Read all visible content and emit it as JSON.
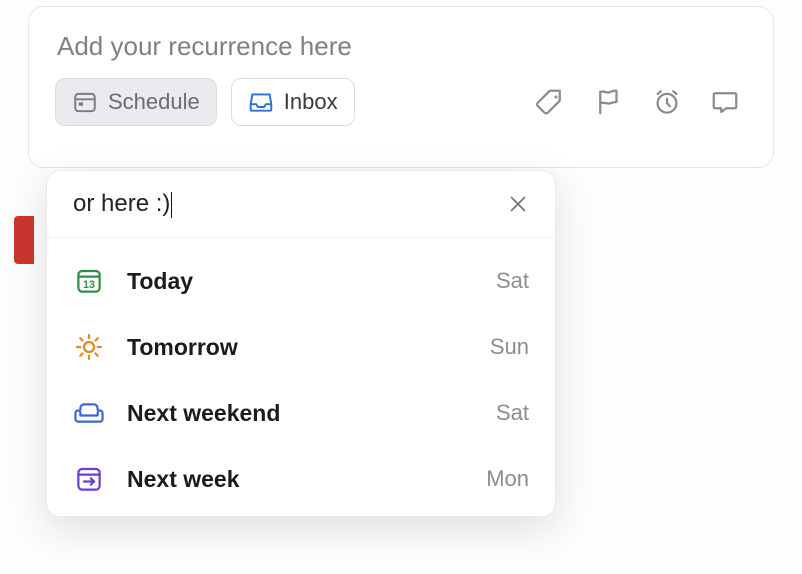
{
  "task": {
    "title_placeholder": "Add your recurrence here",
    "schedule_label": "Schedule",
    "inbox_label": "Inbox"
  },
  "toolbar_icons": {
    "tag": "tag-icon",
    "flag": "flag-icon",
    "reminder": "alarm-icon",
    "comment": "comment-icon"
  },
  "dropdown": {
    "search_text": "or here :)",
    "items": [
      {
        "icon": "calendar-13-icon",
        "icon_color": "#2f8f46",
        "label": "Today",
        "day": "Sat"
      },
      {
        "icon": "sun-icon",
        "icon_color": "#e08a1e",
        "label": "Tomorrow",
        "day": "Sun"
      },
      {
        "icon": "sofa-icon",
        "icon_color": "#3a67d6",
        "label": "Next weekend",
        "day": "Sat"
      },
      {
        "icon": "calendar-next-icon",
        "icon_color": "#6c3dd1",
        "label": "Next week",
        "day": "Mon"
      }
    ]
  },
  "colors": {
    "accent_red": "#c9362e",
    "inbox_icon": "#2f6fd6"
  }
}
